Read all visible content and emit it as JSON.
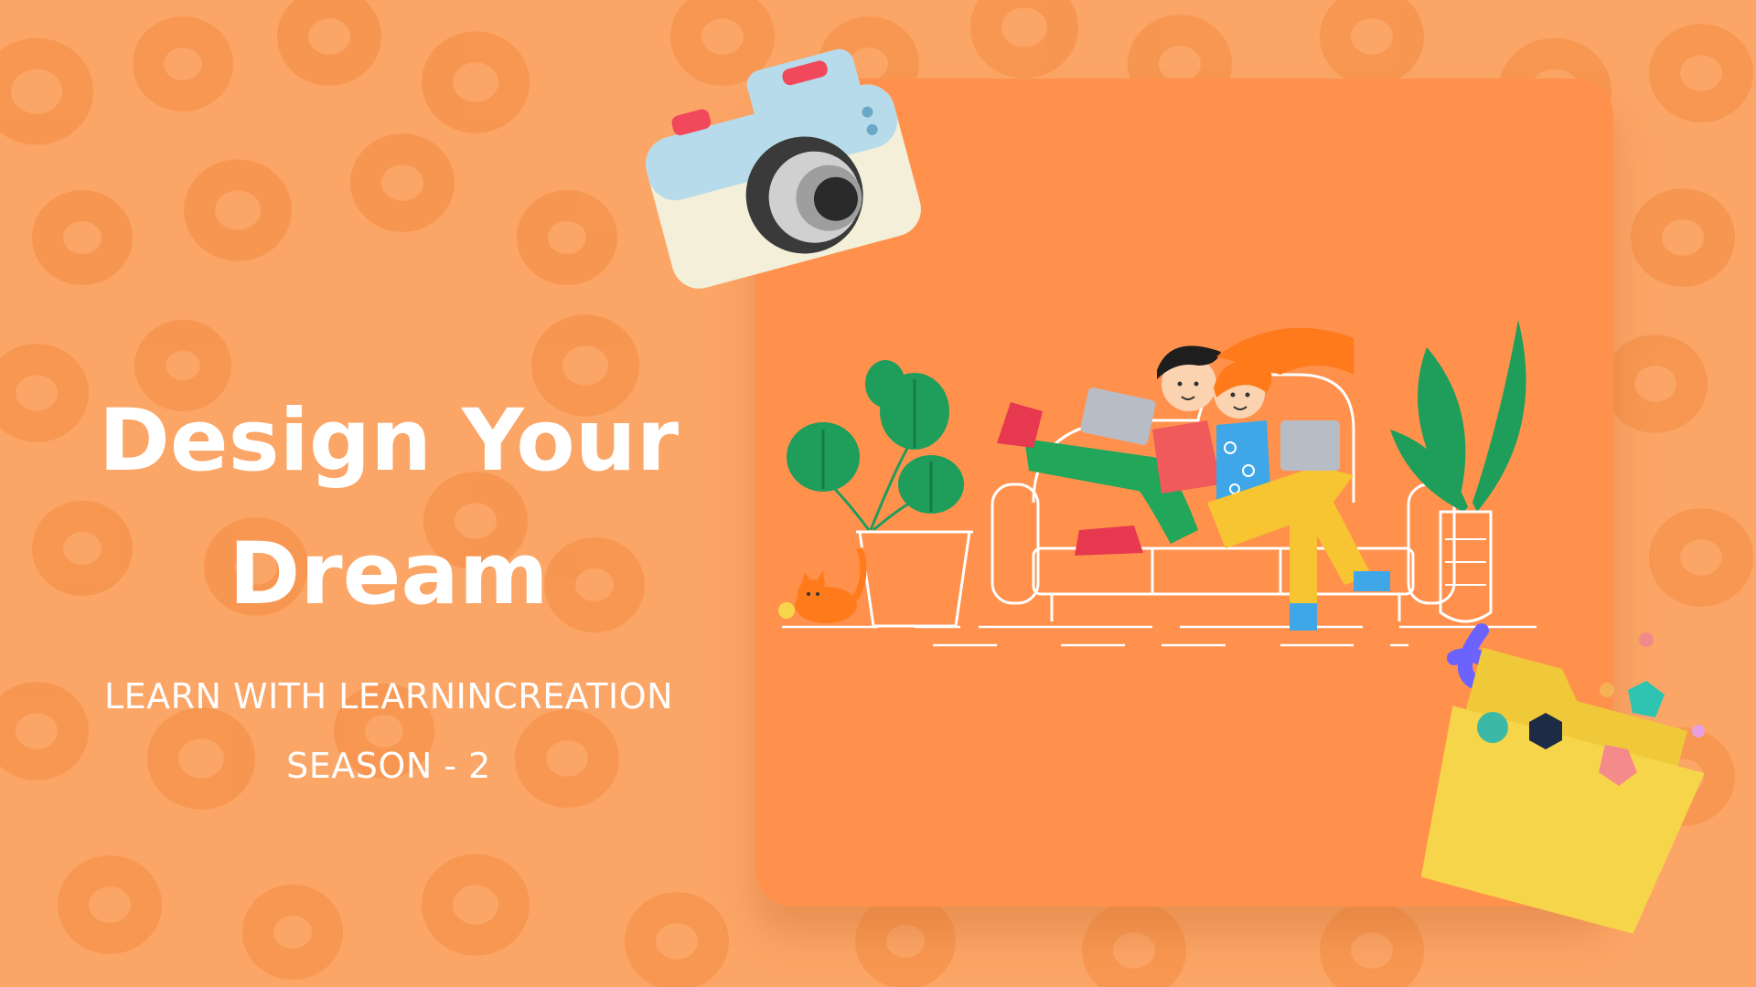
{
  "headline": {
    "line1": "Design Your",
    "line2": "Dream"
  },
  "subtitle": {
    "line1": "LEARN WITH LEARNINCREATION",
    "line2": "SEASON - 2"
  },
  "colors": {
    "background": "#FBA566",
    "pattern": "#F7944E",
    "card": "#FF914D",
    "text": "#FFFFFF",
    "folder": "#F7D54A",
    "plant": "#1F9D5B"
  },
  "icons": [
    "camera-icon",
    "folder-icon",
    "plant-icon",
    "cat-icon",
    "laptop-icon",
    "sofa-icon"
  ]
}
